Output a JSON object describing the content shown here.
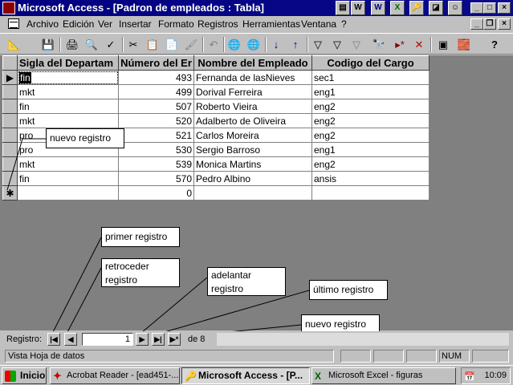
{
  "window": {
    "title": "Microsoft Access - [Padron de empleados : Tabla]",
    "min": "_",
    "max": "□",
    "close": "×",
    "doc_min": "_",
    "doc_restore": "❐",
    "doc_close": "×"
  },
  "tray_icons": [
    "▤",
    "W",
    "X",
    "🔑",
    "◪",
    "☺"
  ],
  "menu": [
    "Archivo",
    "Edición",
    "Ver",
    "Insertar",
    "Formato",
    "Registros",
    "Herramientas",
    "Ventana",
    "?"
  ],
  "toolbar_icons": [
    "📐",
    "💾",
    "🖨",
    "🔍",
    "✓",
    "✂",
    "📋",
    "📄",
    "🖌",
    "↶",
    "🌐",
    "🌐",
    "↓",
    "↑",
    "▽",
    "▽",
    "▽",
    "🔭",
    "▸*",
    "✕",
    "▣",
    "🧱",
    "?"
  ],
  "table": {
    "columns": [
      "Sigla del Departam",
      "Número del Er",
      "Nombre del Empleado",
      "Codigo del Cargo"
    ],
    "rows": [
      [
        "fin",
        "493",
        "Fernanda de lasNieves",
        "sec1"
      ],
      [
        "mkt",
        "499",
        "Dorival Ferreira",
        "eng1"
      ],
      [
        "fin",
        "507",
        "Roberto Vieira",
        "eng2"
      ],
      [
        "mkt",
        "520",
        "Adalberto de Oliveira",
        "eng2"
      ],
      [
        "pro",
        "521",
        "Carlos Moreira",
        "eng2"
      ],
      [
        "pro",
        "530",
        "Sergio Barroso",
        "eng1"
      ],
      [
        "mkt",
        "539",
        "Monica Martins",
        "eng2"
      ],
      [
        "fin",
        "570",
        "Pedro Albino",
        "ansis"
      ]
    ],
    "new_row_number": "0",
    "current_marker": "▶",
    "new_marker": "✱"
  },
  "callouts": {
    "nuevo_registro_top": "nuevo registro",
    "primer_registro": "primer registro",
    "retroceder_registro_1": "retroceder",
    "retroceder_registro_2": "registro",
    "adelantar_registro_1": "adelantar",
    "adelantar_registro_2": "registro",
    "ultimo_registro": "último registro",
    "nuevo_registro_bottom": "nuevo registro"
  },
  "navigation": {
    "label": "Registro:",
    "first": "|◀",
    "prev": "◀",
    "next": "▶",
    "last": "▶|",
    "new": "▶*",
    "current": "1",
    "of_text": "de  8"
  },
  "status": {
    "text": "Vista Hoja de datos",
    "num": "NUM"
  },
  "taskbar": {
    "start": "Inicio",
    "tasks": [
      "Acrobat Reader - [ead451-...",
      "Microsoft Access - [P...",
      "Microsoft Excel - figuras"
    ],
    "clock": "10:09"
  },
  "colors": {
    "title_bar": "#000080",
    "face": "#c0c0c0",
    "workspace": "#808080"
  }
}
